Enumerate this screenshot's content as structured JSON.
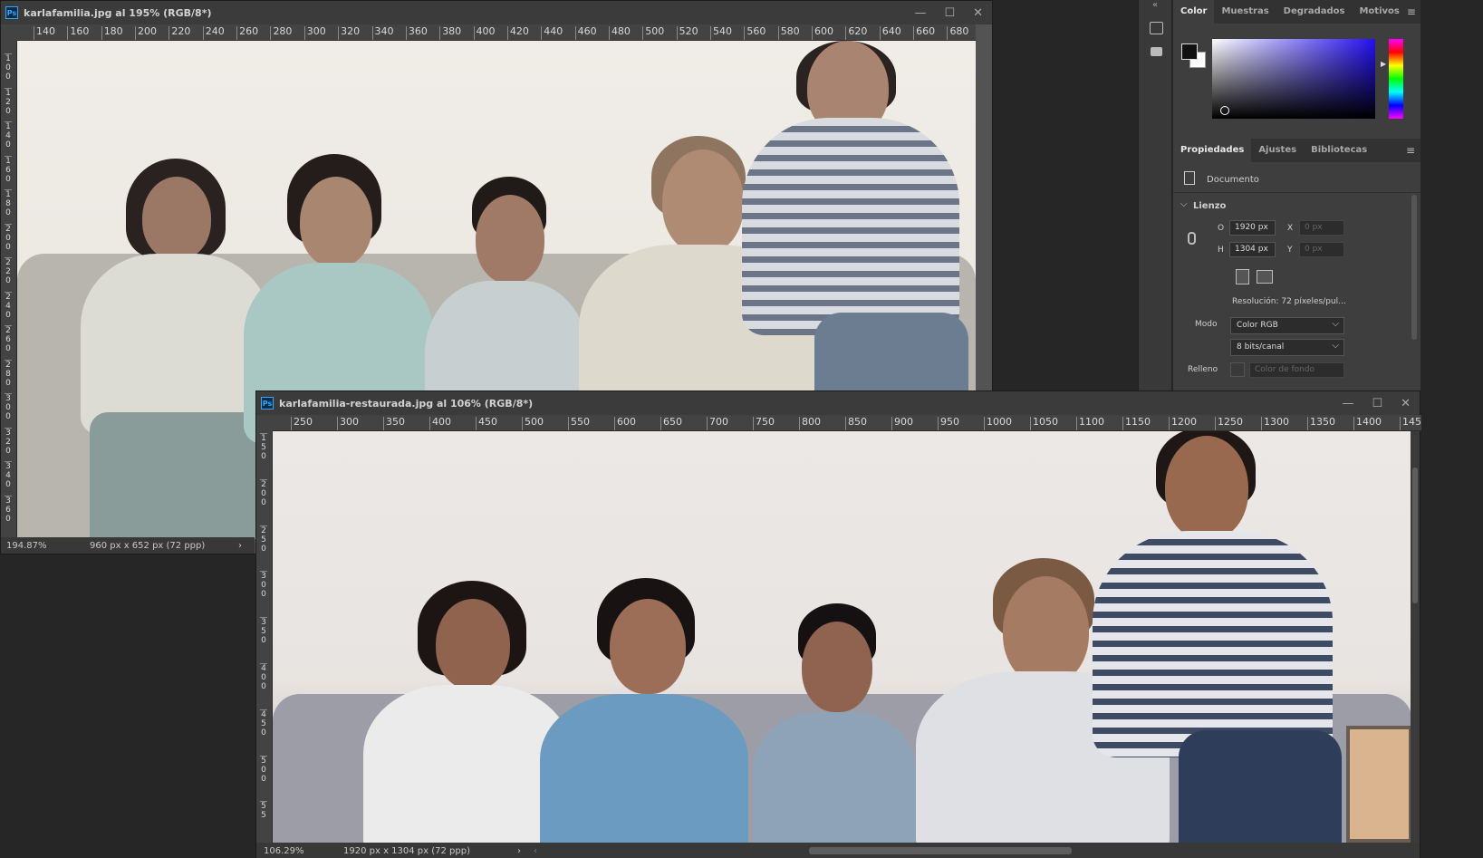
{
  "doc1": {
    "title": "karlafamilia.jpg al 195% (RGB/8*)",
    "ruler_h": [
      "140",
      "160",
      "180",
      "200",
      "220",
      "240",
      "260",
      "280",
      "300",
      "320",
      "340",
      "360",
      "380",
      "400",
      "420",
      "440",
      "460",
      "480",
      "500",
      "520",
      "540",
      "560",
      "580",
      "600",
      "620",
      "640",
      "660",
      "680"
    ],
    "ruler_v": [
      "100",
      "120",
      "140",
      "160",
      "180",
      "200",
      "220",
      "240",
      "260",
      "280",
      "300",
      "320",
      "340",
      "360"
    ],
    "status_zoom": "194.87%",
    "status_info": "960 px x 652 px (72 ppp)"
  },
  "doc2": {
    "title": "karlafamilia-restaurada.jpg al 106% (RGB/8*)",
    "ruler_h": [
      "250",
      "300",
      "350",
      "400",
      "450",
      "500",
      "550",
      "600",
      "650",
      "700",
      "750",
      "800",
      "850",
      "900",
      "950",
      "1000",
      "1050",
      "1100",
      "1150",
      "1200",
      "1250",
      "1300",
      "1350",
      "1400",
      "145"
    ],
    "ruler_v": [
      "150",
      "200",
      "250",
      "300",
      "350",
      "400",
      "450",
      "500",
      "55"
    ],
    "status_zoom": "106.29%",
    "status_info": "1920 px x 1304 px (72 ppp)"
  },
  "color_panel": {
    "tabs": [
      "Color",
      "Muestras",
      "Degradados",
      "Motivos"
    ],
    "accent": "#31a8ff"
  },
  "props_panel": {
    "tabs": [
      "Propiedades",
      "Ajustes",
      "Bibliotecas"
    ],
    "doc_label": "Documento",
    "section": "Lienzo",
    "w_label": "O",
    "w_value": "1920 px",
    "h_label": "H",
    "h_value": "1304 px",
    "x_label": "X",
    "x_value": "0 px",
    "y_label": "Y",
    "y_value": "0 px",
    "resolution": "Resolución: 72 píxeles/pul...",
    "mode_label": "Modo",
    "mode_value": "Color RGB",
    "bits_value": "8 bits/canal",
    "fill_label": "Relleno",
    "fill_value": "Color de fondo"
  }
}
